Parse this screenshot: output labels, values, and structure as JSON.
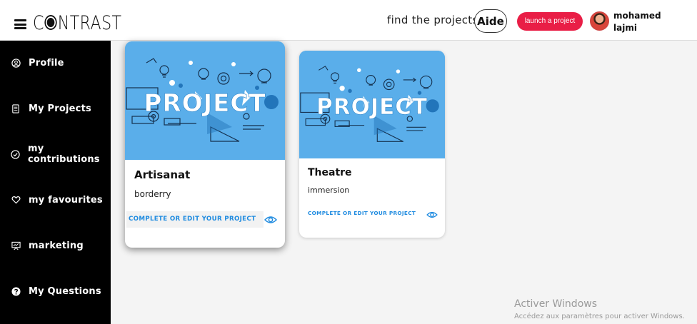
{
  "header": {
    "logo_text": "CONTRAST",
    "find_projects": "find the projects",
    "help_label": "Aide",
    "launch_label": "launch a project",
    "user": {
      "first_name": "mohamed",
      "last_name": "lajmi"
    }
  },
  "sidebar": {
    "items": [
      {
        "label": "Profile",
        "icon": "user-circle-icon"
      },
      {
        "label": "My Projects",
        "icon": "document-icon"
      },
      {
        "label": "my contributions",
        "icon": "check-circle-icon"
      },
      {
        "label": "my favourites",
        "icon": "heart-icon"
      },
      {
        "label": "marketing",
        "icon": "presentation-icon"
      },
      {
        "label": "My Questions",
        "icon": "question-circle-icon"
      }
    ]
  },
  "projects": [
    {
      "title": "Artisanat",
      "subtitle": "borderry",
      "image_text": "PROJECT",
      "action_label": "COMPLETE OR EDIT YOUR PROJECT"
    },
    {
      "title": "Theatre",
      "subtitle": "immersion",
      "image_text": "PROJECT",
      "action_label": "COMPLETE OR EDIT YOUR PROJECT"
    }
  ],
  "watermark": {
    "title": "Activer Windows",
    "subtitle": "Accédez aux paramètres pour activer Windows."
  },
  "colors": {
    "accent": "#e91e46",
    "card_image_bg": "#5aaeea",
    "link_blue": "#1f8be0",
    "sidebar_bg": "#000000"
  }
}
